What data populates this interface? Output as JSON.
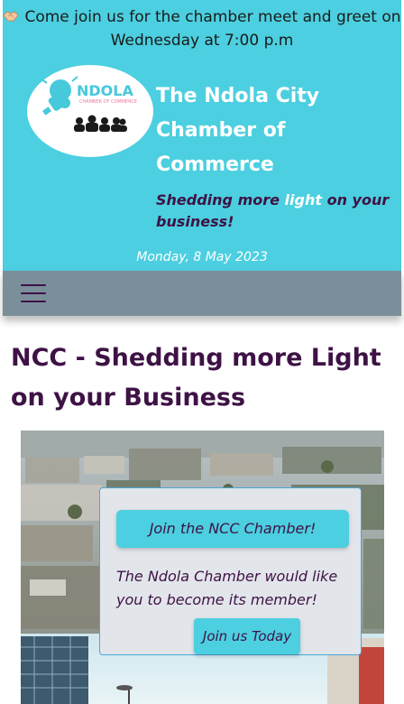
{
  "announcement": {
    "icon": "handshake-icon",
    "text": "Come join us for the chamber meet and greet on Wednesday at 7:00 p.m"
  },
  "logo": {
    "name": "NDOLA",
    "subtitle": "CHAMBER OF COMMERCE"
  },
  "site": {
    "title": "The Ndola City Chamber of Commerce",
    "tagline_before": "Shedding more ",
    "tagline_highlight": "light",
    "tagline_after": " on your business!",
    "date": "Monday, 8 May 2023"
  },
  "nav": {
    "menu_icon": "hamburger-menu-icon"
  },
  "main": {
    "heading": "NCC - Shedding more Light on your Business"
  },
  "cta": {
    "button_label": "Join the NCC Chamber!",
    "text": "The Ndola Chamber would like you to become its member!",
    "join_label": "Join us Today"
  },
  "colors": {
    "header_bg": "#4ccfe0",
    "nav_bg": "#7a8f9a",
    "heading": "#3e1245",
    "accent": "#4ccfe0"
  }
}
